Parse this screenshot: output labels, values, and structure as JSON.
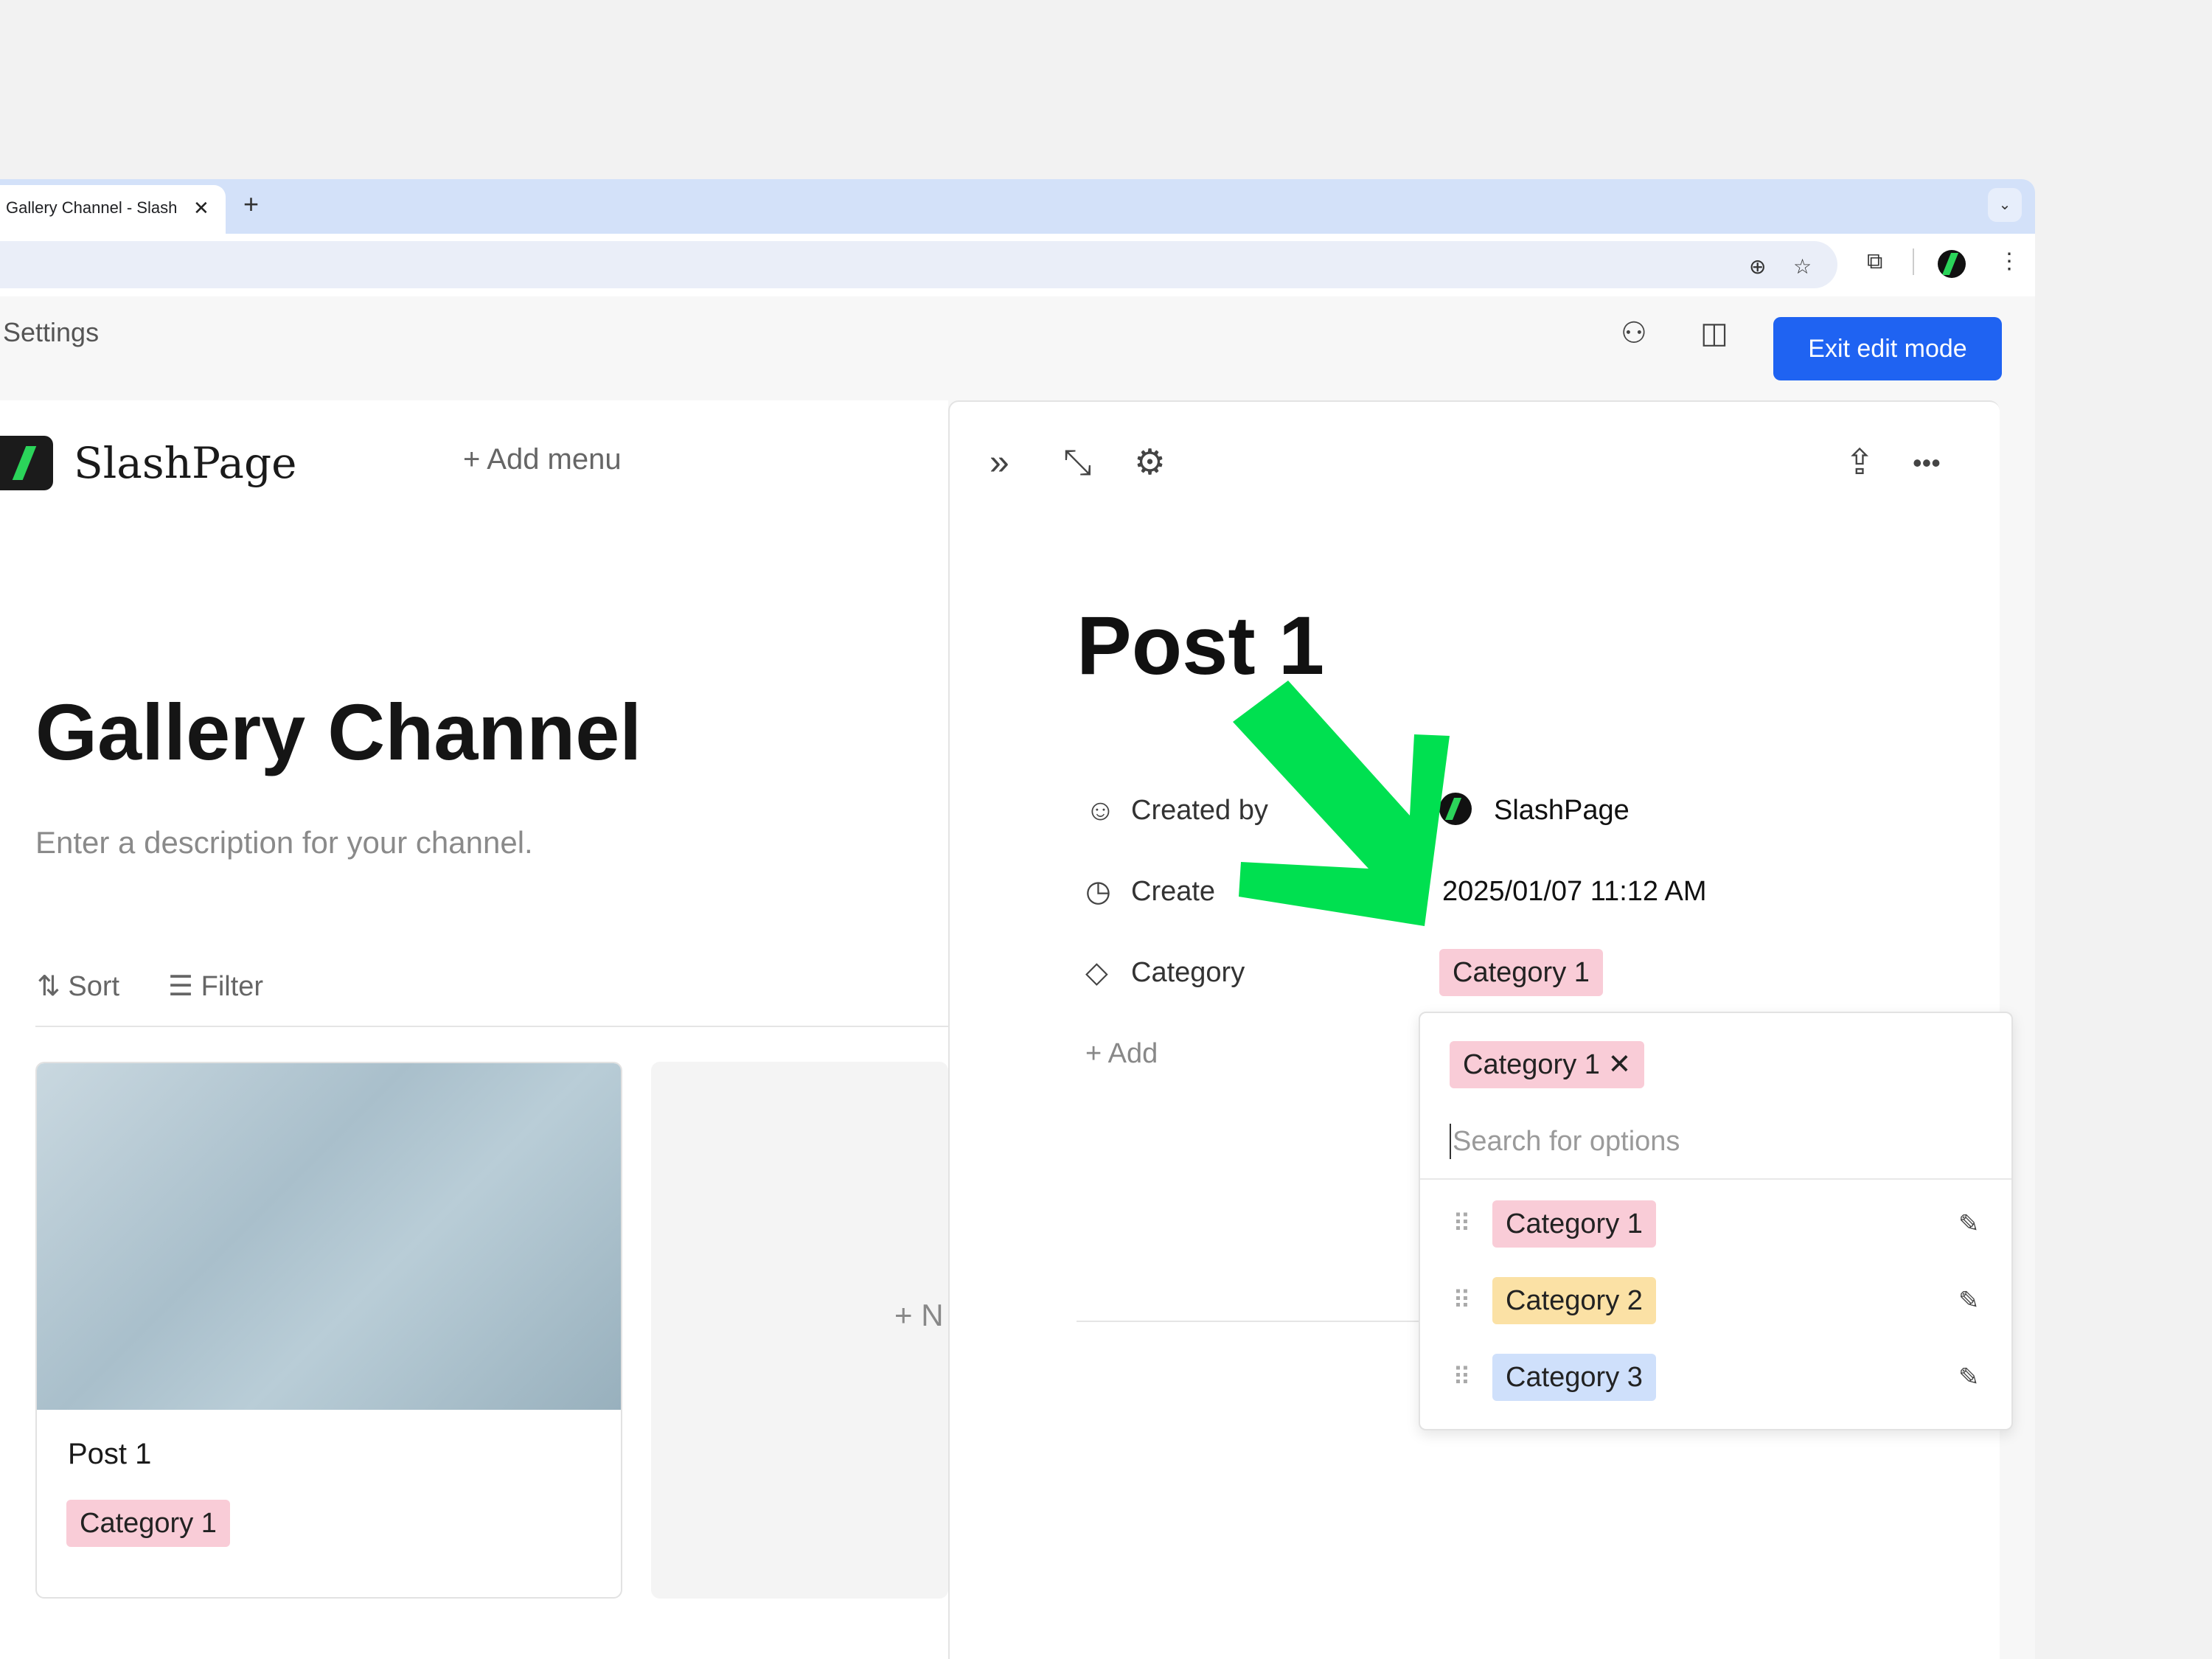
{
  "browser": {
    "tab_title": "Gallery Channel - SlashPage",
    "tab_close": "✕",
    "new_tab": "+",
    "tab_menu": "⌄",
    "zoom_icon": "⊕",
    "star_icon": "☆",
    "extensions_icon": "⧉",
    "menu_icon": "⋮"
  },
  "topbar": {
    "settings": "Settings",
    "invite_icon": "⚇",
    "panel_icon": "◫",
    "exit_button": "Exit edit mode"
  },
  "left": {
    "brand": "SlashPage",
    "add_menu": "+ Add menu",
    "channel_title": "Gallery Channel",
    "channel_description": "Enter a description for your channel.",
    "sort": "⇅ Sort",
    "filter": "☰ Filter",
    "card": {
      "title": "Post 1",
      "tag": "Category 1"
    },
    "new_card": "+ N"
  },
  "post": {
    "collapse_icon": "»",
    "expand_icon": "⤡",
    "settings_icon": "⚙",
    "share_icon": "⇪",
    "more_icon": "•••",
    "title": "Post 1",
    "properties": [
      {
        "icon": "☺",
        "label": "Created by",
        "value": "SlashPage"
      },
      {
        "icon": "◷",
        "label": "Create",
        "value": "2025/01/07 11:12 AM"
      },
      {
        "icon": "◇",
        "label": "Category",
        "value": "Category 1"
      }
    ],
    "add_property": "+ Add"
  },
  "dropdown": {
    "selected": "Category 1 ✕",
    "search_placeholder": "Search for options",
    "options": [
      "Category 1",
      "Category 2",
      "Category 3"
    ],
    "drag_icon": "⠿",
    "edit_icon": "✎"
  },
  "colors": {
    "accent": "#1f63f2",
    "tag_pink": "#f9ccd7",
    "tag_yellow": "#fbe1a5",
    "tag_blue": "#cfe0fb",
    "arrow": "#00e050"
  }
}
